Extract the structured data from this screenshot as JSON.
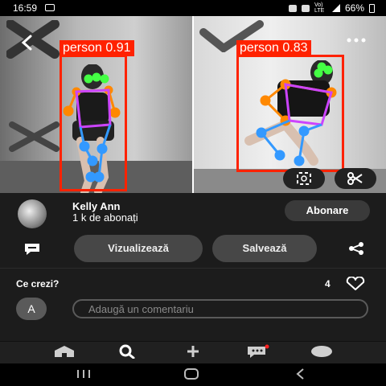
{
  "status_bar": {
    "time": "16:59",
    "network": "Vo) LTE",
    "battery": "66%"
  },
  "photo": {
    "left_detection": {
      "label": "person",
      "score": "0.91"
    },
    "right_detection": {
      "label": "person",
      "score": "0.83"
    },
    "icons": [
      "back-arrow-icon",
      "more-icon",
      "lens-search-icon",
      "scissors-icon"
    ],
    "colors": {
      "box": "#ff2200",
      "skeleton_head": "#44ff44",
      "skeleton_arm": "#ff8800",
      "skeleton_torso": "#cc44ff",
      "skeleton_leg": "#3399ff"
    }
  },
  "author": {
    "name": "Kelly Ann",
    "followers": "1 k de abonați",
    "subscribe_label": "Abonare"
  },
  "actions": {
    "view_label": "Vizualizează",
    "save_label": "Salvează",
    "icons": [
      "chat-bubble-icon",
      "share-icon"
    ]
  },
  "comments": {
    "title": "Ce crezi?",
    "like_count": "4",
    "avatar_letter": "A",
    "input_placeholder": "Adaugă un comentariu"
  },
  "bottom_nav": {
    "items": [
      "home-icon",
      "search-icon",
      "create-icon",
      "messages-icon",
      "profile-icon"
    ]
  },
  "system_nav": {
    "items": [
      "recent-apps-icon",
      "home-button-icon",
      "back-icon"
    ]
  }
}
